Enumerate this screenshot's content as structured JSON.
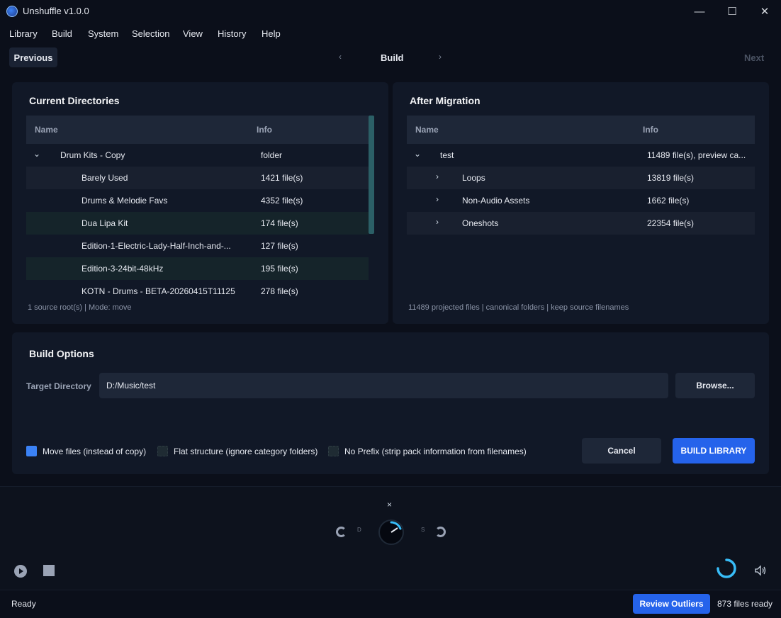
{
  "window": {
    "title": "Unshuffle v1.0.0",
    "controls": {
      "minimize": "—",
      "maximize": "☐",
      "close": "✕"
    }
  },
  "menu": [
    "Library",
    "Build",
    "System",
    "Selection",
    "View",
    "History",
    "Help"
  ],
  "nav": {
    "previous": "Previous",
    "left_arrow": "‹",
    "title": "Build",
    "right_arrow": "›",
    "next": "Next"
  },
  "current": {
    "title": "Current Directories",
    "col_name": "Name",
    "col_info": "Info",
    "rows": [
      {
        "chev": "⌄",
        "name": "Drum Kits - Copy",
        "info": "folder"
      },
      {
        "chev": "",
        "name": "Barely Used",
        "info": "1421 file(s)"
      },
      {
        "chev": "",
        "name": "Drums & Melodie Favs",
        "info": "4352 file(s)"
      },
      {
        "chev": "",
        "name": "Dua Lipa Kit",
        "info": "174 file(s)"
      },
      {
        "chev": "",
        "name": "Edition-1-Electric-Lady-Half-Inch-and-...",
        "info": "127 file(s)"
      },
      {
        "chev": "",
        "name": "Edition-3-24bit-48kHz",
        "info": "195 file(s)"
      },
      {
        "chev": "",
        "name": "KOTN - Drums - BETA-20260415T11125",
        "info": "278 file(s)"
      }
    ],
    "footer": "1 source root(s) | Mode: move"
  },
  "after": {
    "title": "After Migration",
    "col_name": "Name",
    "col_info": "Info",
    "rows": [
      {
        "chev": "⌄",
        "name": "test",
        "info": "11489 file(s), preview ca..."
      },
      {
        "chev": "›",
        "name": "Loops",
        "info": "13819 file(s)"
      },
      {
        "chev": "›",
        "name": "Non-Audio Assets",
        "info": "1662 file(s)"
      },
      {
        "chev": "›",
        "name": "Oneshots",
        "info": "22354 file(s)"
      }
    ],
    "footer": "11489 projected files | canonical folders | keep source filenames"
  },
  "build_options": {
    "title": "Build Options",
    "target_label": "Target Directory",
    "target_value": "D:/Music/test",
    "browse": "Browse...",
    "checkboxes": [
      {
        "label": "Move files (instead of copy)",
        "checked": true
      },
      {
        "label": "Flat structure (ignore category folders)",
        "checked": false
      },
      {
        "label": "No Prefix (strip pack information from filenames)",
        "checked": false
      }
    ],
    "cancel": "Cancel",
    "build": "BUILD LIBRARY"
  },
  "player": {
    "close": "×",
    "left_label": "D",
    "right_label": "S"
  },
  "status": {
    "text": "Ready",
    "review": "Review Outliers",
    "files_ready": "873 files ready"
  },
  "colors": {
    "accent": "#2563eb",
    "spinner": "#38bdf8",
    "background": "#0b0f1a",
    "panel": "#111827"
  }
}
